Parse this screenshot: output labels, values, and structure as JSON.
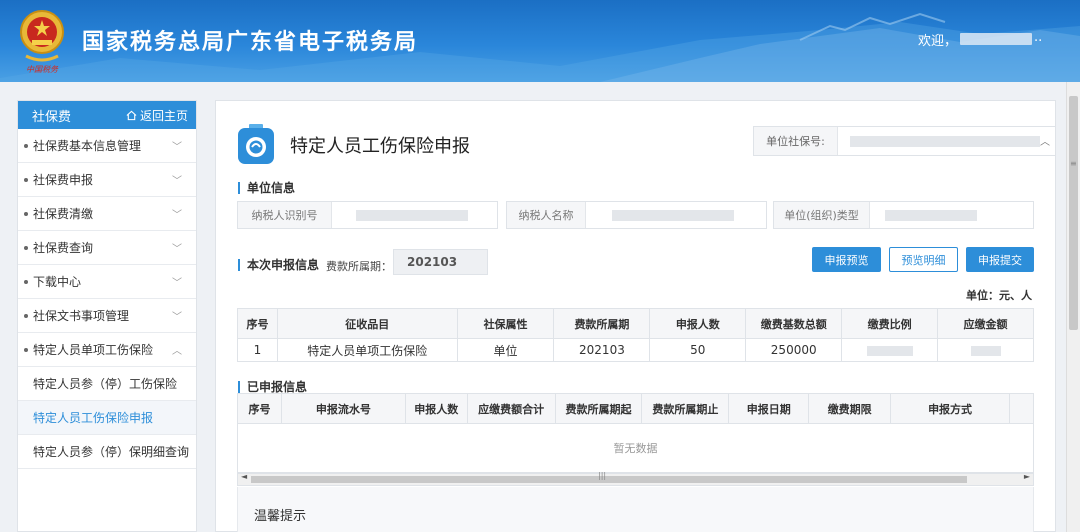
{
  "header": {
    "title": "国家税务总局广东省电子税务局",
    "welcome": "欢迎，",
    "welcome_tail": "..",
    "emblem_caption": "中国税务"
  },
  "sidebar": {
    "title": "社保费",
    "home_link": "返回主页",
    "items": [
      {
        "label": "社保费基本信息管理"
      },
      {
        "label": "社保费申报"
      },
      {
        "label": "社保费清缴"
      },
      {
        "label": "社保费查询"
      },
      {
        "label": "下载中心"
      },
      {
        "label": "社保文书事项管理"
      },
      {
        "label": "特定人员单项工伤保险"
      }
    ],
    "sub_items": [
      {
        "label": "特定人员参（停）工伤保险"
      },
      {
        "label": "特定人员工伤保险申报"
      },
      {
        "label": "特定人员参（停）保明细查询"
      }
    ]
  },
  "main": {
    "title": "特定人员工伤保险申报",
    "unit_social_no_label": "单位社保号:",
    "unit_info_title": "单位信息",
    "fields": {
      "taxpayer_id": "纳税人识别号",
      "taxpayer_name": "纳税人名称",
      "org_type": "单位(组织)类型"
    },
    "current_title": "本次申报信息",
    "period_label": "费款所属期：",
    "period_value": "202103",
    "buttons": {
      "preview": "申报预览",
      "detail": "预览明细",
      "submit": "申报提交"
    },
    "unit_note": "单位：元、人",
    "table1": {
      "headers": [
        "序号",
        "征收品目",
        "社保属性",
        "费款所属期",
        "申报人数",
        "缴费基数总额",
        "缴费比例",
        "应缴金额"
      ],
      "rows": [
        [
          "1",
          "特定人员单项工伤保险",
          "单位",
          "202103",
          "50",
          "250000",
          "",
          ""
        ]
      ]
    },
    "declared_title": "已申报信息",
    "table2": {
      "headers": [
        "序号",
        "申报流水号",
        "申报人数",
        "应缴费额合计",
        "费款所属期起",
        "费款所属期止",
        "申报日期",
        "缴费期限",
        "申报方式"
      ]
    },
    "empty_text": "暂无数据",
    "tips_title": "温馨提示"
  },
  "colors": {
    "accent": "#2d8ed9",
    "header_top": "#1b6fc4",
    "header_bottom": "#4aa0e4"
  }
}
